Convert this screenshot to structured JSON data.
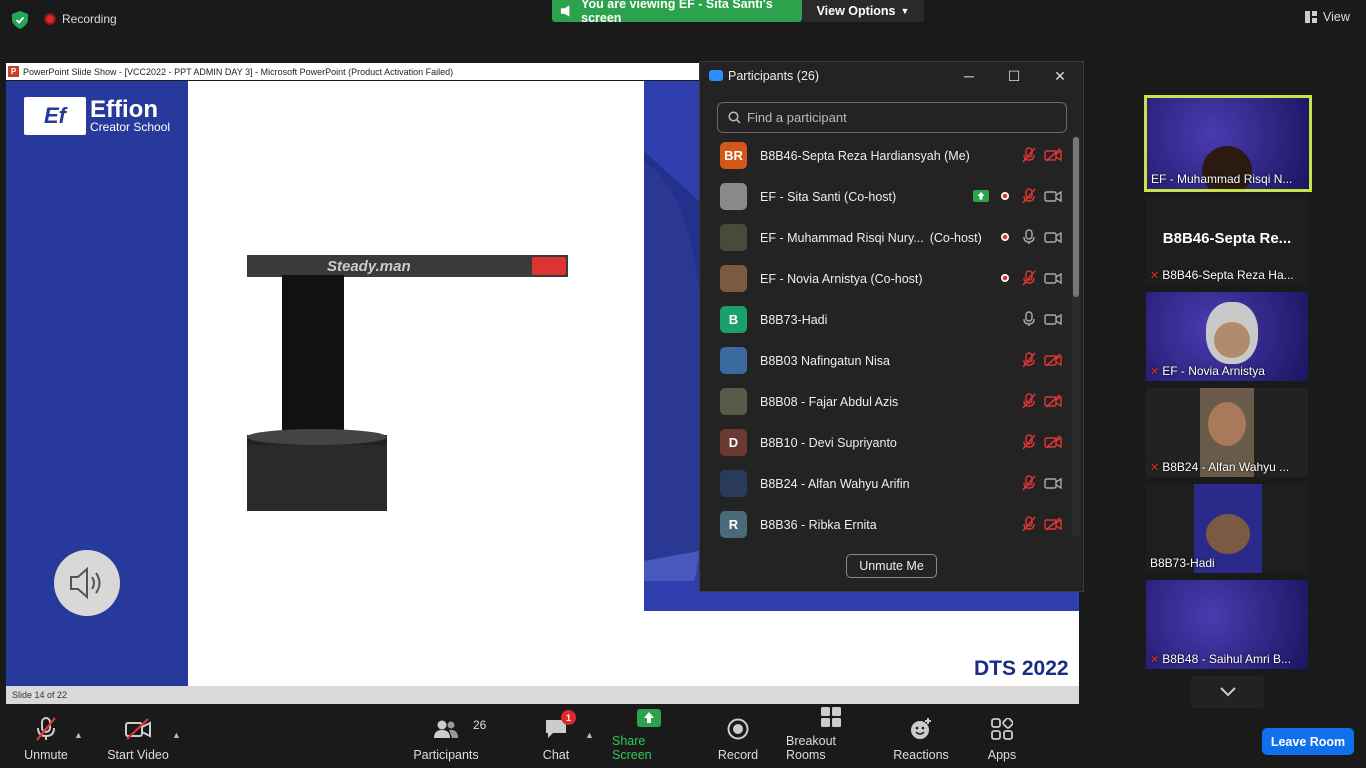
{
  "top": {
    "recording_label": "Recording",
    "viewing_banner": "You are viewing EF - Sita Santi's screen",
    "view_options_label": "View Options",
    "view_label": "View"
  },
  "ppt": {
    "window_title": "PowerPoint Slide Show - [VCC2022 - PPT ADMIN DAY 3] - Microsoft PowerPoint (Product Activation Failed)",
    "logo_mark": "Ef",
    "logo_name": "Effion",
    "logo_sub": "Creator School",
    "product_text": "Steady.man",
    "footer_text": "DTS 2022",
    "status_text": "Slide 14 of 22"
  },
  "participants": {
    "title": "Participants (26)",
    "search_placeholder": "Find a participant",
    "unmute_me_label": "Unmute Me",
    "items": [
      {
        "name": "B8B46-Septa Reza Hardiansyah (Me)",
        "avatar": "BR",
        "avatar_color": "#d4571a",
        "record": false,
        "share": false,
        "mic": "muted",
        "video": "off"
      },
      {
        "name": "EF - Sita Santi (Co-host)",
        "avatar": "",
        "avatar_color": "#8a8a8a",
        "record": true,
        "share": true,
        "mic": "muted",
        "video": "on"
      },
      {
        "name": "EF - Muhammad Risqi Nury...",
        "suffix": "(Co-host)",
        "avatar": "",
        "avatar_color": "#4a4a3a",
        "record": true,
        "share": false,
        "mic": "on",
        "video": "on"
      },
      {
        "name": "EF - Novia Arnistya (Co-host)",
        "avatar": "",
        "avatar_color": "#7a5a40",
        "record": true,
        "share": false,
        "mic": "muted",
        "video": "on"
      },
      {
        "name": "B8B73-Hadi",
        "avatar": "B",
        "avatar_color": "#1aa06a",
        "record": false,
        "share": false,
        "mic": "on",
        "video": "on"
      },
      {
        "name": "B8B03 Nafingatun Nisa",
        "avatar": "",
        "avatar_color": "#3a6aa0",
        "record": false,
        "share": false,
        "mic": "muted",
        "video": "off"
      },
      {
        "name": "B8B08 - Fajar Abdul Azis",
        "avatar": "",
        "avatar_color": "#5a5a4a",
        "record": false,
        "share": false,
        "mic": "muted",
        "video": "off"
      },
      {
        "name": "B8B10 - Devi Supriyanto",
        "avatar": "D",
        "avatar_color": "#6a3a30",
        "record": false,
        "share": false,
        "mic": "muted",
        "video": "off"
      },
      {
        "name": "B8B24 - Alfan Wahyu Arifin",
        "avatar": "",
        "avatar_color": "#2a3a5a",
        "record": false,
        "share": false,
        "mic": "muted",
        "video": "on"
      },
      {
        "name": "B8B36 - Ribka Ernita",
        "avatar": "R",
        "avatar_color": "#4a6a7a",
        "record": false,
        "share": false,
        "mic": "muted",
        "video": "off"
      }
    ]
  },
  "gallery": {
    "tiles": [
      {
        "label": "EF - Muhammad Risqi N...",
        "muted": false
      },
      {
        "label": "B8B46-Septa Reza Ha...",
        "name_big": "B8B46-Septa Re...",
        "muted": true
      },
      {
        "label": "EF - Novia Arnistya",
        "muted": true
      },
      {
        "label": "B8B24 - Alfan Wahyu ...",
        "muted": true
      },
      {
        "label": "B8B73-Hadi",
        "muted": false
      },
      {
        "label": "B8B48 - Saihul Amri B...",
        "muted": true
      }
    ]
  },
  "toolbar": {
    "unmute": "Unmute",
    "start_video": "Start Video",
    "participants": "Participants",
    "participants_count": "26",
    "chat": "Chat",
    "chat_badge": "1",
    "share_screen": "Share Screen",
    "record": "Record",
    "breakout_rooms": "Breakout Rooms",
    "reactions": "Reactions",
    "apps": "Apps",
    "leave_room": "Leave Room"
  },
  "colors": {
    "share_green": "#2ca24c",
    "zoom_blue": "#0e71eb",
    "muted_red": "#e03535",
    "slide_blue": "#27399a"
  }
}
